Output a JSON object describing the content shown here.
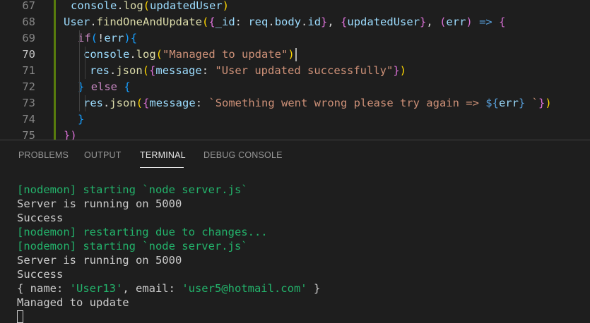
{
  "editor": {
    "lines": [
      {
        "n": "67",
        "active": false,
        "indent": 100,
        "tokens": [
          [
            "tk-var",
            "console"
          ],
          [
            "tk-plain",
            "."
          ],
          [
            "tk-fn",
            "log"
          ],
          [
            "tk-b1",
            "("
          ],
          [
            "tk-var",
            "updatedUser"
          ],
          [
            "tk-b1",
            ")"
          ]
        ]
      },
      {
        "n": "68",
        "active": false,
        "indent": 90,
        "tokens": [
          [
            "tk-var",
            "User"
          ],
          [
            "tk-plain",
            "."
          ],
          [
            "tk-fn",
            "findOneAndUpdate"
          ],
          [
            "tk-b1",
            "("
          ],
          [
            "tk-b2",
            "{"
          ],
          [
            "tk-var",
            "_id"
          ],
          [
            "tk-plain",
            ": "
          ],
          [
            "tk-var",
            "req"
          ],
          [
            "tk-plain",
            "."
          ],
          [
            "tk-var",
            "body"
          ],
          [
            "tk-plain",
            "."
          ],
          [
            "tk-var",
            "id"
          ],
          [
            "tk-b2",
            "}"
          ],
          [
            "tk-plain",
            ", "
          ],
          [
            "tk-b2",
            "{"
          ],
          [
            "tk-var",
            "updatedUser"
          ],
          [
            "tk-b2",
            "}"
          ],
          [
            "tk-plain",
            ", "
          ],
          [
            "tk-b2",
            "("
          ],
          [
            "tk-var",
            "err"
          ],
          [
            "tk-b2",
            ")"
          ],
          [
            "tk-plain",
            " "
          ],
          [
            "tk-op",
            "=>"
          ],
          [
            "tk-plain",
            " "
          ],
          [
            "tk-b2",
            "{"
          ]
        ]
      },
      {
        "n": "69",
        "active": false,
        "indent": 110,
        "tokens": [
          [
            "tk-kw",
            "if"
          ],
          [
            "tk-b3",
            "("
          ],
          [
            "tk-plain",
            "!"
          ],
          [
            "tk-var",
            "err"
          ],
          [
            "tk-b3",
            ")"
          ],
          [
            "tk-b3",
            "{"
          ]
        ]
      },
      {
        "n": "70",
        "active": true,
        "indent": 118,
        "tokens": [
          [
            "tk-var",
            "console"
          ],
          [
            "tk-plain",
            "."
          ],
          [
            "tk-fn",
            "log"
          ],
          [
            "tk-b1",
            "("
          ],
          [
            "tk-str",
            "\"Managed to update\""
          ],
          [
            "tk-b1",
            ")"
          ]
        ],
        "cursor": true
      },
      {
        "n": "71",
        "active": false,
        "indent": 127,
        "tokens": [
          [
            "tk-var",
            "res"
          ],
          [
            "tk-plain",
            "."
          ],
          [
            "tk-fn",
            "json"
          ],
          [
            "tk-b1",
            "("
          ],
          [
            "tk-b2",
            "{"
          ],
          [
            "tk-var",
            "message"
          ],
          [
            "tk-plain",
            ": "
          ],
          [
            "tk-str",
            "\"User updated successfully\""
          ],
          [
            "tk-b2",
            "}"
          ],
          [
            "tk-b1",
            ")"
          ]
        ]
      },
      {
        "n": "72",
        "active": false,
        "indent": 110,
        "tokens": [
          [
            "tk-b3",
            "}"
          ],
          [
            "tk-plain",
            " "
          ],
          [
            "tk-kw",
            "else"
          ],
          [
            "tk-plain",
            " "
          ],
          [
            "tk-b3",
            "{"
          ]
        ]
      },
      {
        "n": "73",
        "active": false,
        "indent": 118,
        "tokens": [
          [
            "tk-var",
            "res"
          ],
          [
            "tk-plain",
            "."
          ],
          [
            "tk-fn",
            "json"
          ],
          [
            "tk-b1",
            "("
          ],
          [
            "tk-b2",
            "{"
          ],
          [
            "tk-var",
            "message"
          ],
          [
            "tk-plain",
            ": "
          ],
          [
            "tk-str",
            "`Something went wrong please try again => "
          ],
          [
            "tk-tpl",
            "${"
          ],
          [
            "tk-var",
            "err"
          ],
          [
            "tk-tpl",
            "}"
          ],
          [
            "tk-str",
            " `"
          ],
          [
            "tk-b2",
            "}"
          ],
          [
            "tk-b1",
            ")"
          ]
        ]
      },
      {
        "n": "74",
        "active": false,
        "indent": 110,
        "tokens": [
          [
            "tk-b3",
            "}"
          ]
        ]
      },
      {
        "n": "75",
        "active": false,
        "indent": 90,
        "tokens": [
          [
            "tk-b2",
            "})"
          ]
        ]
      }
    ]
  },
  "panel": {
    "tabs": [
      {
        "label": "PROBLEMS",
        "active": false
      },
      {
        "label": "OUTPUT",
        "active": false
      },
      {
        "label": "TERMINAL",
        "active": true
      },
      {
        "label": "DEBUG CONSOLE",
        "active": false
      }
    ],
    "terminal_lines": [
      {
        "style": "green",
        "text": "[nodemon] starting `node server.js`"
      },
      {
        "style": "plain",
        "text": "Server is running on 5000"
      },
      {
        "style": "plain",
        "text": "Success"
      },
      {
        "style": "green",
        "text": "[nodemon] restarting due to changes..."
      },
      {
        "style": "green",
        "text": "[nodemon] starting `node server.js`"
      },
      {
        "style": "plain",
        "text": "Server is running on 5000"
      },
      {
        "style": "plain",
        "text": "Success"
      },
      {
        "style": "obj",
        "parts": [
          [
            "plain",
            "{ name: "
          ],
          [
            "green",
            "'User13'"
          ],
          [
            "plain",
            ", email: "
          ],
          [
            "green",
            "'user5@hotmail.com'"
          ],
          [
            "plain",
            " }"
          ]
        ]
      },
      {
        "style": "plain",
        "text": "Managed to update"
      }
    ]
  },
  "colors": {
    "background": "#1e1e1e",
    "terminal_green": "#23b36b",
    "git_modified": "#587c0c"
  }
}
